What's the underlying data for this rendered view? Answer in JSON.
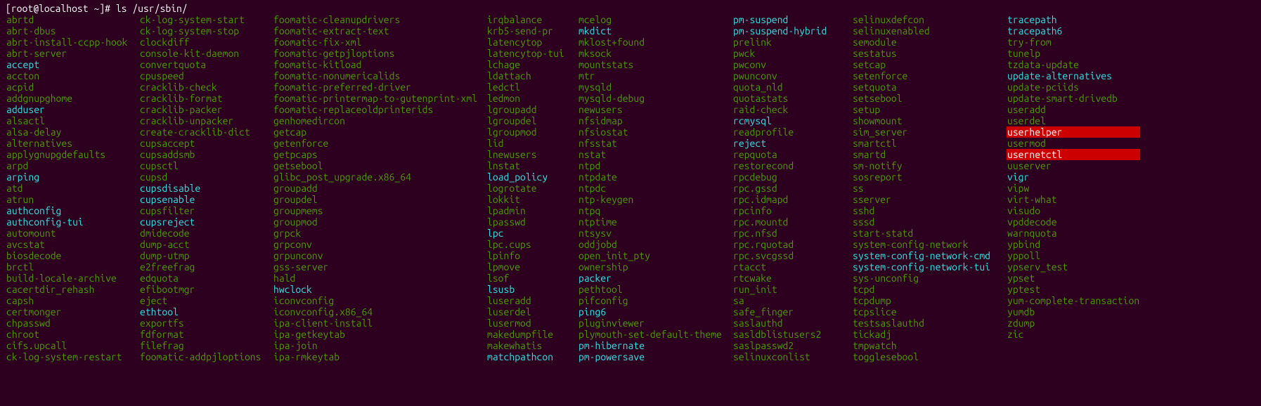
{
  "prompt": {
    "user_host": "[root@localhost ~]#",
    "command": "ls /usr/sbin/"
  },
  "columns": [
    [
      {
        "name": "abrtd",
        "style": "green"
      },
      {
        "name": "abrt-dbus",
        "style": "green"
      },
      {
        "name": "abrt-install-ccpp-hook",
        "style": "green"
      },
      {
        "name": "abrt-server",
        "style": "green"
      },
      {
        "name": "accept",
        "style": "cyan"
      },
      {
        "name": "accton",
        "style": "green"
      },
      {
        "name": "acpid",
        "style": "green"
      },
      {
        "name": "addgnupghome",
        "style": "green"
      },
      {
        "name": "adduser",
        "style": "cyan"
      },
      {
        "name": "alsactl",
        "style": "green"
      },
      {
        "name": "alsa-delay",
        "style": "green"
      },
      {
        "name": "alternatives",
        "style": "green"
      },
      {
        "name": "applygnupgdefaults",
        "style": "green"
      },
      {
        "name": "arpd",
        "style": "green"
      },
      {
        "name": "arping",
        "style": "cyan"
      },
      {
        "name": "atd",
        "style": "green"
      },
      {
        "name": "atrun",
        "style": "green"
      },
      {
        "name": "authconfig",
        "style": "cyan"
      },
      {
        "name": "authconfig-tui",
        "style": "cyan"
      },
      {
        "name": "automount",
        "style": "green"
      },
      {
        "name": "avcstat",
        "style": "green"
      },
      {
        "name": "biosdecode",
        "style": "green"
      },
      {
        "name": "brctl",
        "style": "green"
      },
      {
        "name": "build-locale-archive",
        "style": "green"
      },
      {
        "name": "cacertdir_rehash",
        "style": "green"
      },
      {
        "name": "capsh",
        "style": "green"
      },
      {
        "name": "certmonger",
        "style": "green"
      },
      {
        "name": "chpasswd",
        "style": "green"
      },
      {
        "name": "chroot",
        "style": "green"
      },
      {
        "name": "cifs.upcall",
        "style": "green"
      },
      {
        "name": "ck-log-system-restart",
        "style": "green"
      }
    ],
    [
      {
        "name": "ck-log-system-start",
        "style": "green"
      },
      {
        "name": "ck-log-system-stop",
        "style": "green"
      },
      {
        "name": "clockdiff",
        "style": "green"
      },
      {
        "name": "console-kit-daemon",
        "style": "green"
      },
      {
        "name": "convertquota",
        "style": "green"
      },
      {
        "name": "cpuspeed",
        "style": "green"
      },
      {
        "name": "cracklib-check",
        "style": "green"
      },
      {
        "name": "cracklib-format",
        "style": "green"
      },
      {
        "name": "cracklib-packer",
        "style": "green"
      },
      {
        "name": "cracklib-unpacker",
        "style": "green"
      },
      {
        "name": "create-cracklib-dict",
        "style": "green"
      },
      {
        "name": "cupsaccept",
        "style": "green"
      },
      {
        "name": "cupsaddsmb",
        "style": "green"
      },
      {
        "name": "cupsctl",
        "style": "green"
      },
      {
        "name": "cupsd",
        "style": "green"
      },
      {
        "name": "cupsdisable",
        "style": "cyan"
      },
      {
        "name": "cupsenable",
        "style": "cyan"
      },
      {
        "name": "cupsfilter",
        "style": "green"
      },
      {
        "name": "cupsreject",
        "style": "cyan"
      },
      {
        "name": "dmidecode",
        "style": "green"
      },
      {
        "name": "dump-acct",
        "style": "green"
      },
      {
        "name": "dump-utmp",
        "style": "green"
      },
      {
        "name": "e2freefrag",
        "style": "green"
      },
      {
        "name": "edquota",
        "style": "green"
      },
      {
        "name": "efibootmgr",
        "style": "green"
      },
      {
        "name": "eject",
        "style": "green"
      },
      {
        "name": "ethtool",
        "style": "cyan"
      },
      {
        "name": "exportfs",
        "style": "green"
      },
      {
        "name": "fdformat",
        "style": "green"
      },
      {
        "name": "filefrag",
        "style": "green"
      },
      {
        "name": "foomatic-addpjloptions",
        "style": "green"
      }
    ],
    [
      {
        "name": "foomatic-cleanupdrivers",
        "style": "green"
      },
      {
        "name": "foomatic-extract-text",
        "style": "green"
      },
      {
        "name": "foomatic-fix-xml",
        "style": "green"
      },
      {
        "name": "foomatic-getpjloptions",
        "style": "green"
      },
      {
        "name": "foomatic-kitload",
        "style": "green"
      },
      {
        "name": "foomatic-nonumericalids",
        "style": "green"
      },
      {
        "name": "foomatic-preferred-driver",
        "style": "green"
      },
      {
        "name": "foomatic-printermap-to-gutenprint-xml",
        "style": "green"
      },
      {
        "name": "foomatic-replaceoldprinterids",
        "style": "green"
      },
      {
        "name": "genhomedircon",
        "style": "green"
      },
      {
        "name": "getcap",
        "style": "green"
      },
      {
        "name": "getenforce",
        "style": "green"
      },
      {
        "name": "getpcaps",
        "style": "green"
      },
      {
        "name": "getsebool",
        "style": "green"
      },
      {
        "name": "glibc_post_upgrade.x86_64",
        "style": "green"
      },
      {
        "name": "groupadd",
        "style": "green"
      },
      {
        "name": "groupdel",
        "style": "green"
      },
      {
        "name": "groupmems",
        "style": "green"
      },
      {
        "name": "groupmod",
        "style": "green"
      },
      {
        "name": "grpck",
        "style": "green"
      },
      {
        "name": "grpconv",
        "style": "green"
      },
      {
        "name": "grpunconv",
        "style": "green"
      },
      {
        "name": "gss-server",
        "style": "green"
      },
      {
        "name": "hald",
        "style": "green"
      },
      {
        "name": "hwclock",
        "style": "cyan"
      },
      {
        "name": "iconvconfig",
        "style": "green"
      },
      {
        "name": "iconvconfig.x86_64",
        "style": "green"
      },
      {
        "name": "ipa-client-install",
        "style": "green"
      },
      {
        "name": "ipa-getkeytab",
        "style": "green"
      },
      {
        "name": "ipa-join",
        "style": "green"
      },
      {
        "name": "ipa-rmkeytab",
        "style": "green"
      }
    ],
    [
      {
        "name": "irqbalance",
        "style": "green"
      },
      {
        "name": "krb5-send-pr",
        "style": "green"
      },
      {
        "name": "latencytop",
        "style": "green"
      },
      {
        "name": "latencytop-tui",
        "style": "green"
      },
      {
        "name": "lchage",
        "style": "green"
      },
      {
        "name": "ldattach",
        "style": "green"
      },
      {
        "name": "ledctl",
        "style": "green"
      },
      {
        "name": "ledmon",
        "style": "green"
      },
      {
        "name": "lgroupadd",
        "style": "green"
      },
      {
        "name": "lgroupdel",
        "style": "green"
      },
      {
        "name": "lgroupmod",
        "style": "green"
      },
      {
        "name": "lid",
        "style": "green"
      },
      {
        "name": "lnewusers",
        "style": "green"
      },
      {
        "name": "lnstat",
        "style": "green"
      },
      {
        "name": "load_policy",
        "style": "cyan"
      },
      {
        "name": "logrotate",
        "style": "green"
      },
      {
        "name": "lokkit",
        "style": "green"
      },
      {
        "name": "lpadmin",
        "style": "green"
      },
      {
        "name": "lpasswd",
        "style": "green"
      },
      {
        "name": "lpc",
        "style": "cyan"
      },
      {
        "name": "lpc.cups",
        "style": "green"
      },
      {
        "name": "lpinfo",
        "style": "green"
      },
      {
        "name": "lpmove",
        "style": "green"
      },
      {
        "name": "lsof",
        "style": "green"
      },
      {
        "name": "lsusb",
        "style": "cyan"
      },
      {
        "name": "luseradd",
        "style": "green"
      },
      {
        "name": "luserdel",
        "style": "green"
      },
      {
        "name": "lusermod",
        "style": "green"
      },
      {
        "name": "makedumpfile",
        "style": "green"
      },
      {
        "name": "makewhatis",
        "style": "green"
      },
      {
        "name": "matchpathcon",
        "style": "cyan"
      }
    ],
    [
      {
        "name": "mcelog",
        "style": "green"
      },
      {
        "name": "mkdict",
        "style": "cyan"
      },
      {
        "name": "mklost+found",
        "style": "green"
      },
      {
        "name": "mksock",
        "style": "green"
      },
      {
        "name": "mountstats",
        "style": "green"
      },
      {
        "name": "mtr",
        "style": "green"
      },
      {
        "name": "mysqld",
        "style": "green"
      },
      {
        "name": "mysqld-debug",
        "style": "green"
      },
      {
        "name": "newusers",
        "style": "green"
      },
      {
        "name": "nfsidmap",
        "style": "green"
      },
      {
        "name": "nfsiostat",
        "style": "green"
      },
      {
        "name": "nfsstat",
        "style": "green"
      },
      {
        "name": "nstat",
        "style": "green"
      },
      {
        "name": "ntpd",
        "style": "green"
      },
      {
        "name": "ntpdate",
        "style": "green"
      },
      {
        "name": "ntpdc",
        "style": "green"
      },
      {
        "name": "ntp-keygen",
        "style": "green"
      },
      {
        "name": "ntpq",
        "style": "green"
      },
      {
        "name": "ntptime",
        "style": "green"
      },
      {
        "name": "ntsysv",
        "style": "green"
      },
      {
        "name": "oddjobd",
        "style": "green"
      },
      {
        "name": "open_init_pty",
        "style": "green"
      },
      {
        "name": "ownership",
        "style": "green"
      },
      {
        "name": "packer",
        "style": "cyan"
      },
      {
        "name": "pethtool",
        "style": "green"
      },
      {
        "name": "pifconfig",
        "style": "green"
      },
      {
        "name": "ping6",
        "style": "cyan"
      },
      {
        "name": "pluginviewer",
        "style": "green"
      },
      {
        "name": "plymouth-set-default-theme",
        "style": "green"
      },
      {
        "name": "pm-hibernate",
        "style": "cyan"
      },
      {
        "name": "pm-powersave",
        "style": "cyan"
      }
    ],
    [
      {
        "name": "pm-suspend",
        "style": "cyan"
      },
      {
        "name": "pm-suspend-hybrid",
        "style": "cyan"
      },
      {
        "name": "prelink",
        "style": "green"
      },
      {
        "name": "pwck",
        "style": "green"
      },
      {
        "name": "pwconv",
        "style": "green"
      },
      {
        "name": "pwunconv",
        "style": "green"
      },
      {
        "name": "quota_nld",
        "style": "green"
      },
      {
        "name": "quotastats",
        "style": "green"
      },
      {
        "name": "raid-check",
        "style": "green"
      },
      {
        "name": "rcmysql",
        "style": "cyan"
      },
      {
        "name": "readprofile",
        "style": "green"
      },
      {
        "name": "reject",
        "style": "cyan"
      },
      {
        "name": "repquota",
        "style": "green"
      },
      {
        "name": "restorecond",
        "style": "green"
      },
      {
        "name": "rpcdebug",
        "style": "green"
      },
      {
        "name": "rpc.gssd",
        "style": "green"
      },
      {
        "name": "rpc.idmapd",
        "style": "green"
      },
      {
        "name": "rpcinfo",
        "style": "green"
      },
      {
        "name": "rpc.mountd",
        "style": "green"
      },
      {
        "name": "rpc.nfsd",
        "style": "green"
      },
      {
        "name": "rpc.rquotad",
        "style": "green"
      },
      {
        "name": "rpc.svcgssd",
        "style": "green"
      },
      {
        "name": "rtacct",
        "style": "green"
      },
      {
        "name": "rtcwake",
        "style": "green"
      },
      {
        "name": "run_init",
        "style": "green"
      },
      {
        "name": "sa",
        "style": "green"
      },
      {
        "name": "safe_finger",
        "style": "green"
      },
      {
        "name": "saslauthd",
        "style": "green"
      },
      {
        "name": "sasldblistusers2",
        "style": "green"
      },
      {
        "name": "saslpasswd2",
        "style": "green"
      },
      {
        "name": "selinuxconlist",
        "style": "green"
      }
    ],
    [
      {
        "name": "selinuxdefcon",
        "style": "green"
      },
      {
        "name": "selinuxenabled",
        "style": "green"
      },
      {
        "name": "semodule",
        "style": "green"
      },
      {
        "name": "sestatus",
        "style": "green"
      },
      {
        "name": "setcap",
        "style": "green"
      },
      {
        "name": "setenforce",
        "style": "green"
      },
      {
        "name": "setquota",
        "style": "green"
      },
      {
        "name": "setsebool",
        "style": "green"
      },
      {
        "name": "setup",
        "style": "green"
      },
      {
        "name": "showmount",
        "style": "green"
      },
      {
        "name": "sim_server",
        "style": "green"
      },
      {
        "name": "smartctl",
        "style": "green"
      },
      {
        "name": "smartd",
        "style": "green"
      },
      {
        "name": "sm-notify",
        "style": "green"
      },
      {
        "name": "sosreport",
        "style": "green"
      },
      {
        "name": "ss",
        "style": "green"
      },
      {
        "name": "sserver",
        "style": "green"
      },
      {
        "name": "sshd",
        "style": "green"
      },
      {
        "name": "sssd",
        "style": "green"
      },
      {
        "name": "start-statd",
        "style": "green"
      },
      {
        "name": "system-config-network",
        "style": "green"
      },
      {
        "name": "system-config-network-cmd",
        "style": "cyan"
      },
      {
        "name": "system-config-network-tui",
        "style": "cyan"
      },
      {
        "name": "sys-unconfig",
        "style": "green"
      },
      {
        "name": "tcpd",
        "style": "green"
      },
      {
        "name": "tcpdump",
        "style": "green"
      },
      {
        "name": "tcpslice",
        "style": "green"
      },
      {
        "name": "testsaslauthd",
        "style": "green"
      },
      {
        "name": "tickadj",
        "style": "green"
      },
      {
        "name": "tmpwatch",
        "style": "green"
      },
      {
        "name": "togglesebool",
        "style": "green"
      }
    ],
    [
      {
        "name": "tracepath",
        "style": "cyan"
      },
      {
        "name": "tracepath6",
        "style": "cyan"
      },
      {
        "name": "try-from",
        "style": "green"
      },
      {
        "name": "tunelp",
        "style": "green"
      },
      {
        "name": "tzdata-update",
        "style": "green"
      },
      {
        "name": "update-alternatives",
        "style": "cyan"
      },
      {
        "name": "update-pciids",
        "style": "green"
      },
      {
        "name": "update-smart-drivedb",
        "style": "green"
      },
      {
        "name": "useradd",
        "style": "green"
      },
      {
        "name": "userdel",
        "style": "green"
      },
      {
        "name": "userhelper",
        "style": "hl"
      },
      {
        "name": "usermod",
        "style": "green"
      },
      {
        "name": "usernetctl",
        "style": "hl"
      },
      {
        "name": "uuserver",
        "style": "green"
      },
      {
        "name": "vigr",
        "style": "cyan"
      },
      {
        "name": "vipw",
        "style": "green"
      },
      {
        "name": "virt-what",
        "style": "green"
      },
      {
        "name": "visudo",
        "style": "green"
      },
      {
        "name": "vpddecode",
        "style": "green"
      },
      {
        "name": "warnquota",
        "style": "green"
      },
      {
        "name": "ypbind",
        "style": "green"
      },
      {
        "name": "yppoll",
        "style": "green"
      },
      {
        "name": "ypserv_test",
        "style": "green"
      },
      {
        "name": "ypset",
        "style": "green"
      },
      {
        "name": "yptest",
        "style": "green"
      },
      {
        "name": "yum-complete-transaction",
        "style": "green"
      },
      {
        "name": "yumdb",
        "style": "green"
      },
      {
        "name": "zdump",
        "style": "green"
      },
      {
        "name": "zic",
        "style": "green"
      }
    ]
  ]
}
